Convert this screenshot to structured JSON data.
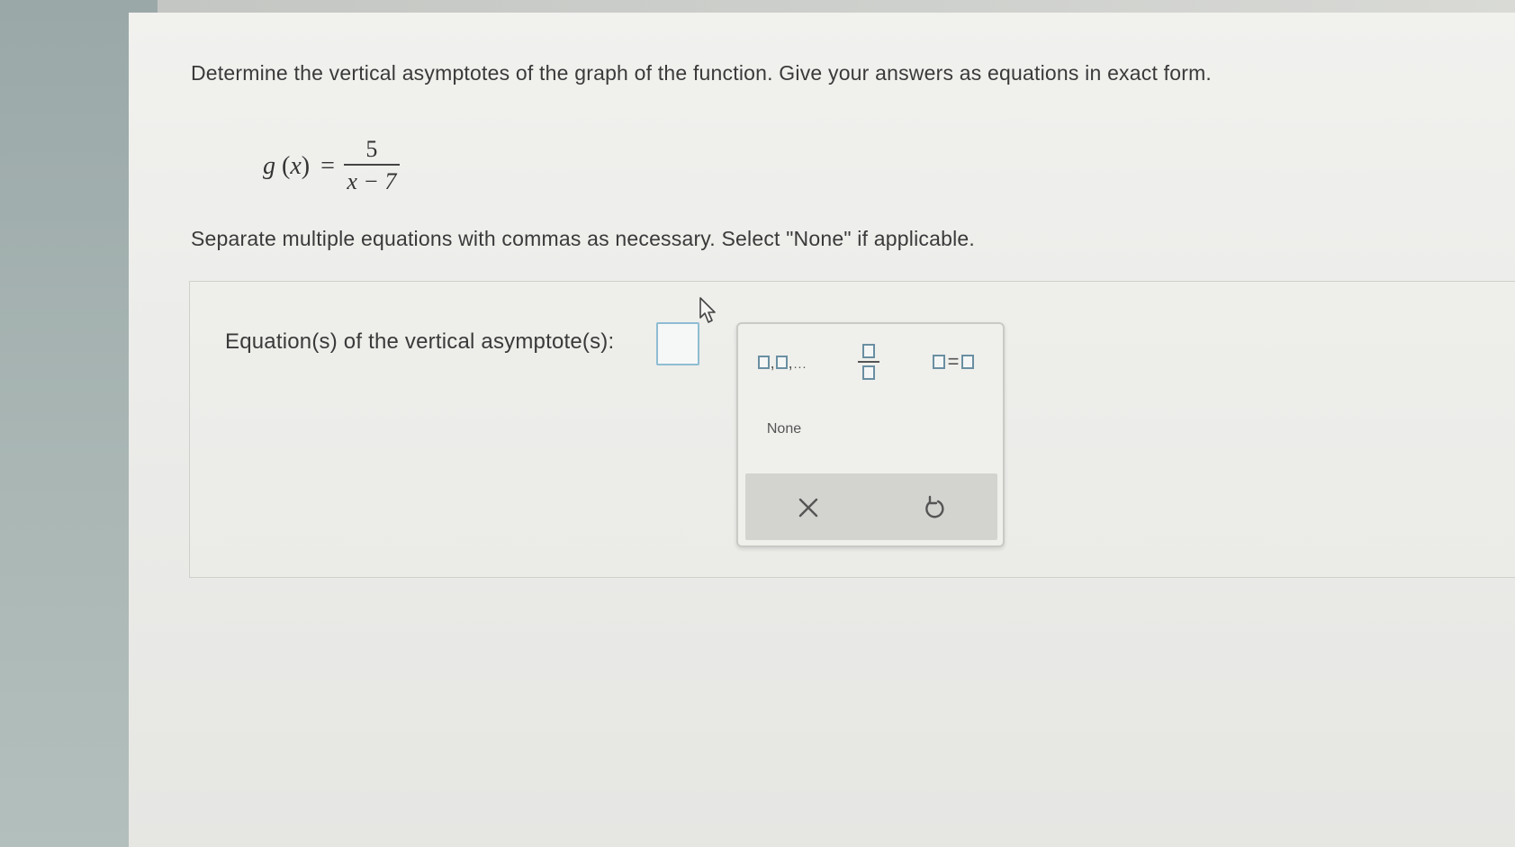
{
  "question": {
    "prompt": "Determine the vertical asymptotes of the graph of the function. Give your answers as equations in exact form.",
    "function": {
      "name": "g",
      "variable": "x",
      "numerator": "5",
      "denominator": "x − 7"
    },
    "instructions": "Separate multiple equations with commas as necessary. Select \"None\" if applicable."
  },
  "answer": {
    "label": "Equation(s) of the vertical asymptote(s):",
    "value": ""
  },
  "palette": {
    "buttons": [
      {
        "name": "list-template",
        "icon": "comma-list-icon"
      },
      {
        "name": "fraction-template",
        "icon": "fraction-icon"
      },
      {
        "name": "equation-template",
        "icon": "equation-icon"
      }
    ],
    "none_label": "None",
    "clear_icon": "close-icon",
    "undo_icon": "undo-icon"
  },
  "colors": {
    "input_border": "#8fbcd2",
    "template_box": "#6a8fa2",
    "action_bar": "#d3d3d0"
  }
}
